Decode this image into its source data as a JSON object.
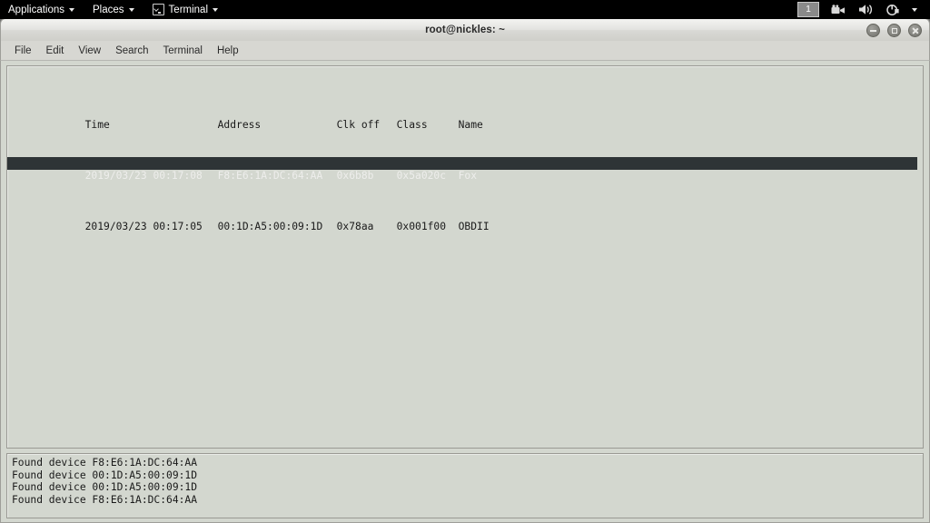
{
  "panel": {
    "menus": [
      {
        "label": "Applications",
        "icon": "",
        "has_arrow": true
      },
      {
        "label": "Places",
        "icon": "",
        "has_arrow": true
      },
      {
        "label": "Terminal",
        "icon": "terminal-icon",
        "has_arrow": true
      }
    ],
    "tray": {
      "workspace": "1",
      "icons": [
        "video-camera-icon",
        "volume-speaker-icon",
        "power-icon",
        "chevron-down-icon"
      ]
    }
  },
  "window": {
    "title": "root@nickles: ~",
    "controls": {
      "minimize": "minimize-button",
      "maximize": "maximize-button",
      "close": "close-button"
    }
  },
  "menubar": {
    "items": [
      "File",
      "Edit",
      "View",
      "Search",
      "Terminal",
      "Help"
    ]
  },
  "device_table": {
    "headers": {
      "time": "Time",
      "address": "Address",
      "clk_off": "Clk off",
      "class": "Class",
      "name": "Name"
    },
    "rows": [
      {
        "time": "2019/03/23 00:17:08",
        "address": "F8:E6:1A:DC:64:AA",
        "clk_off": "0x6b8b",
        "class": "0x5a020c",
        "name": "Fox",
        "selected": true
      },
      {
        "time": "2019/03/23 00:17:05",
        "address": "00:1D:A5:00:09:1D",
        "clk_off": "0x78aa",
        "class": "0x001f00",
        "name": "OBDII",
        "selected": false
      }
    ]
  },
  "log": {
    "lines": [
      "Found device F8:E6:1A:DC:64:AA",
      "Found device 00:1D:A5:00:09:1D",
      "Found device 00:1D:A5:00:09:1D",
      "Found device F8:E6:1A:DC:64:AA"
    ]
  },
  "colors": {
    "panel_bg": "#000000",
    "window_bg": "#d3d7cf",
    "selection_bg": "#2e3436",
    "selection_fg": "#eeeeec",
    "desktop_bg": "#6e6e6e"
  }
}
